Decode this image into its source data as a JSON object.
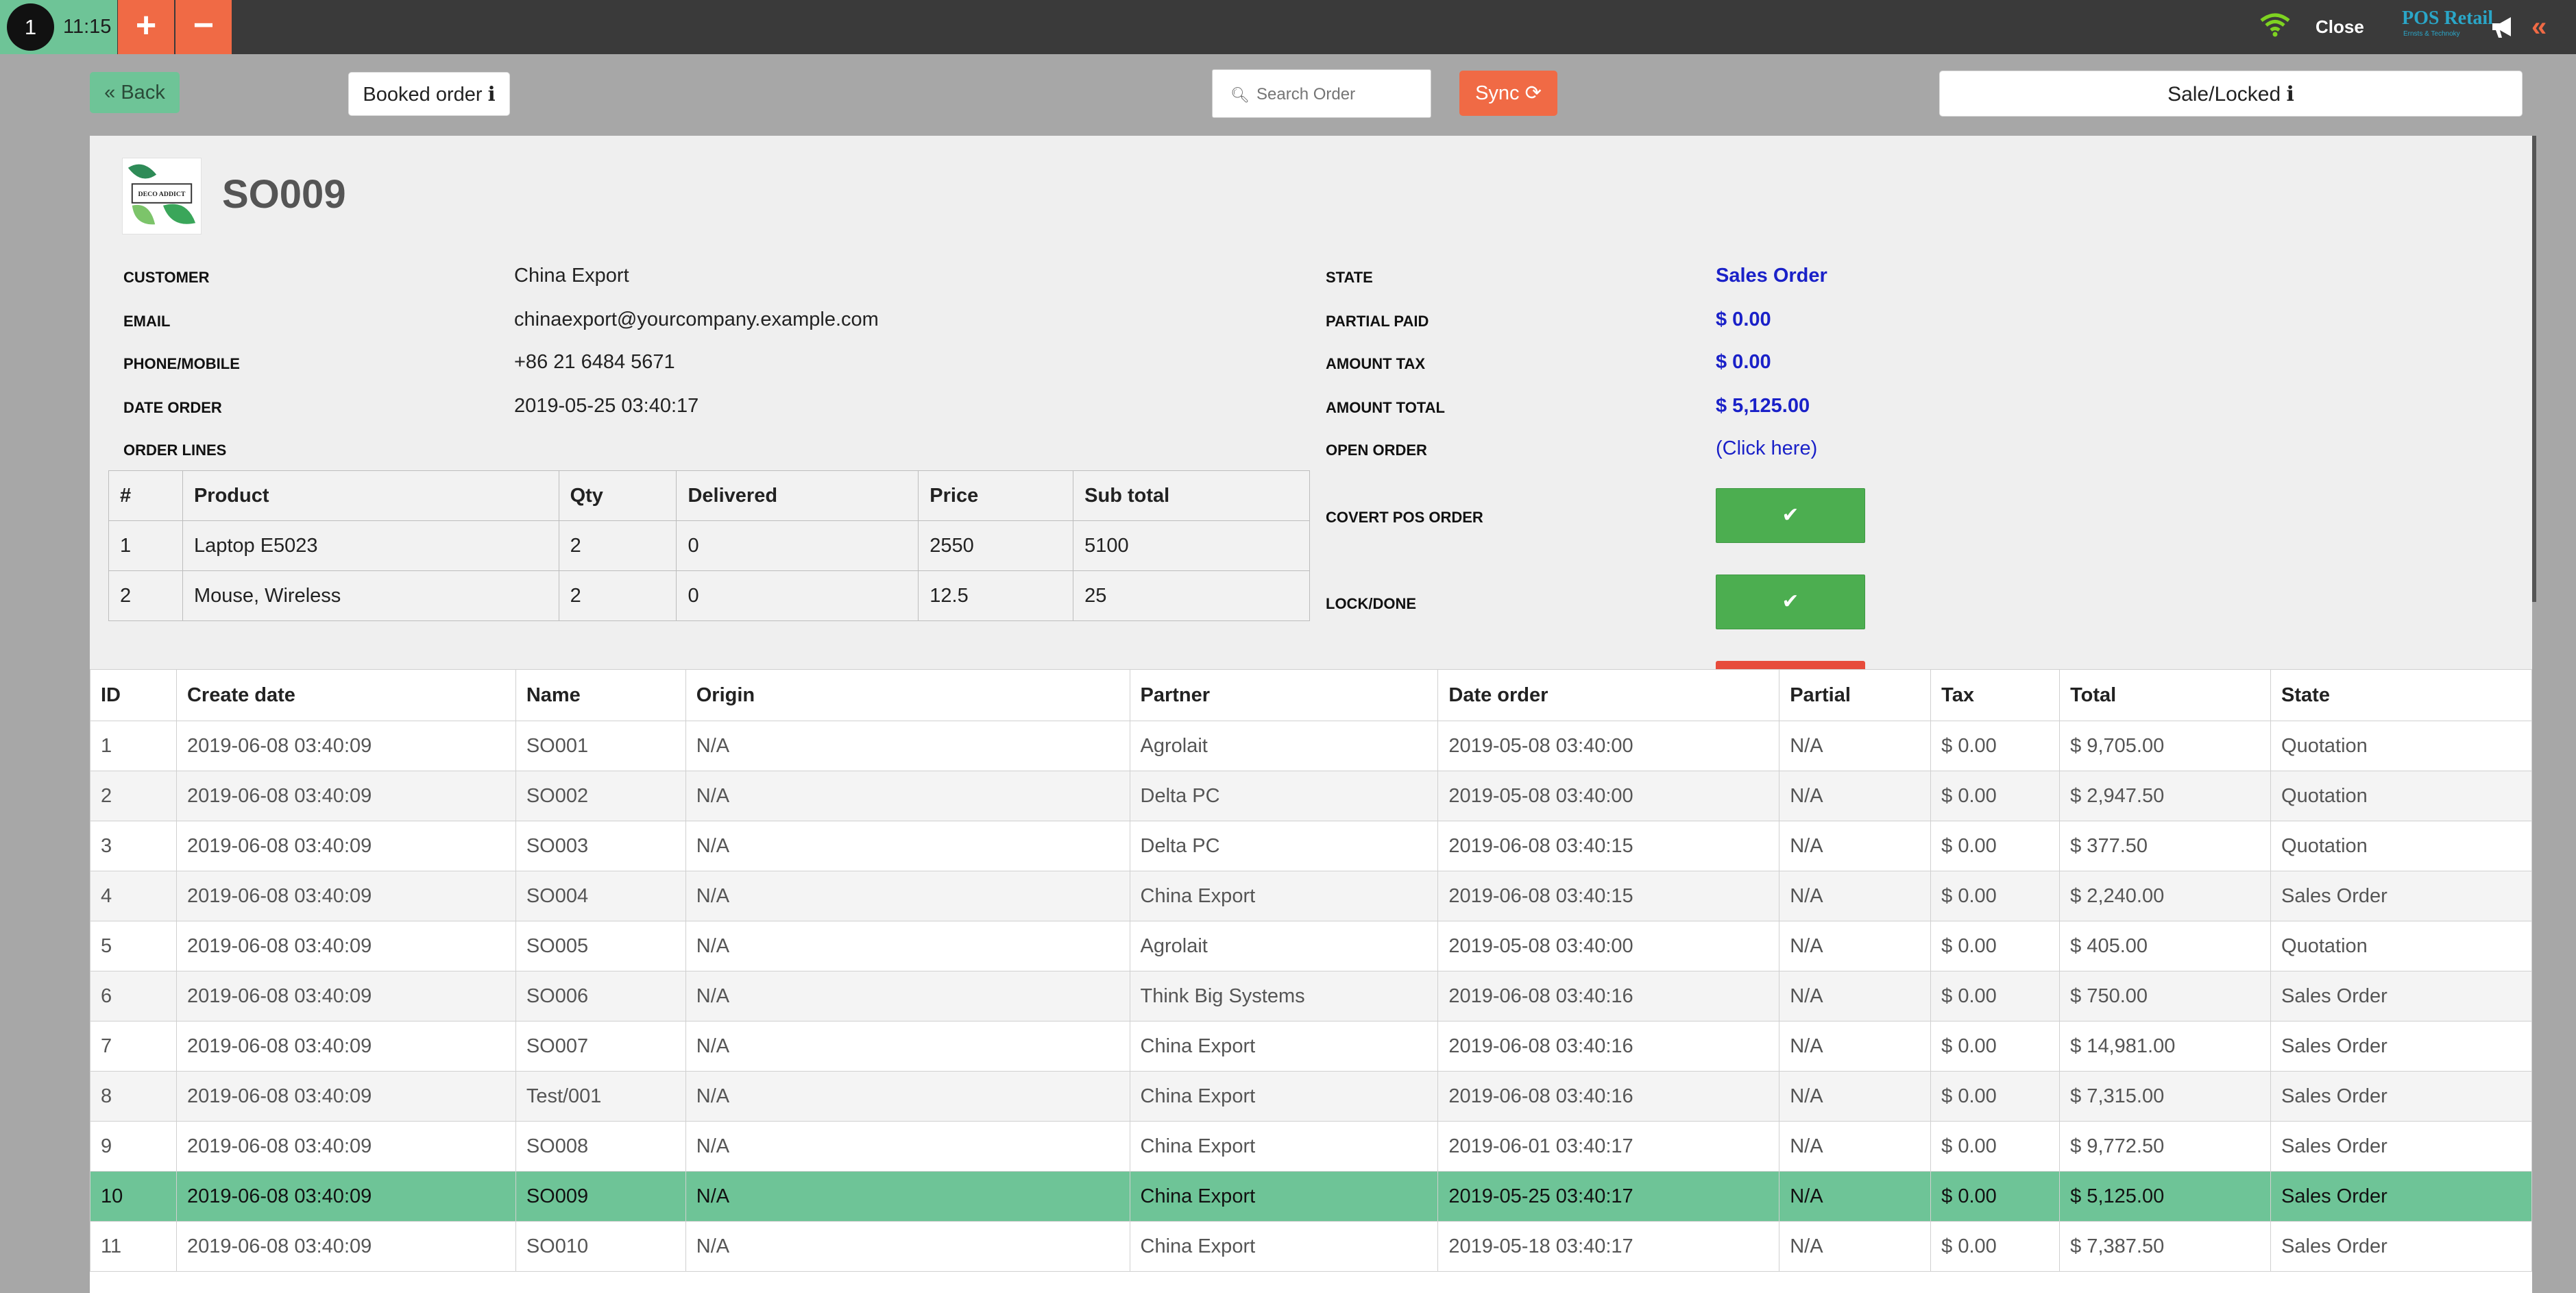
{
  "topbar": {
    "order_number": "1",
    "order_time": "11:15",
    "add_label": "+",
    "remove_label": "−",
    "close_label": "Close",
    "logo_text": "POS Retail",
    "logo_sub": "Ernsts & Technoky",
    "collapse_label": "«"
  },
  "toolbar": {
    "back_label": "« Back",
    "booked_label": "Booked order ℹ",
    "search_placeholder": "Search Order",
    "sync_label": "Sync ⟳",
    "sale_locked_label": "Sale/Locked ℹ"
  },
  "detail": {
    "logo_text": "DECO ADDICT",
    "title": "SO009",
    "left_fields": [
      {
        "label": "CUSTOMER",
        "value": "China Export"
      },
      {
        "label": "EMAIL",
        "value": "chinaexport@yourcompany.example.com"
      },
      {
        "label": "PHONE/MOBILE",
        "value": "+86 21 6484 5671"
      },
      {
        "label": "DATE ORDER",
        "value": "2019-05-25 03:40:17"
      }
    ],
    "order_lines_label": "ORDER LINES",
    "right_fields": [
      {
        "label": "STATE",
        "value": "Sales Order"
      },
      {
        "label": "PARTIAL PAID",
        "value": "$ 0.00"
      },
      {
        "label": "AMOUNT TAX",
        "value": "$ 0.00"
      },
      {
        "label": "AMOUNT TOTAL",
        "value": "$ 5,125.00"
      }
    ],
    "open_order_label": "OPEN ORDER",
    "open_order_link": "(Click here)",
    "covert_label": "COVERT POS ORDER",
    "lock_label": "LOCK/DONE",
    "check_glyph": "✔",
    "lines_headers": [
      "#",
      "Product",
      "Qty",
      "Delivered",
      "Price",
      "Sub total"
    ],
    "lines": [
      [
        "1",
        "Laptop E5023",
        "2",
        "0",
        "2550",
        "5100"
      ],
      [
        "2",
        "Mouse, Wireless",
        "2",
        "0",
        "12.5",
        "25"
      ]
    ]
  },
  "orders": {
    "headers": [
      "ID",
      "Create date",
      "Name",
      "Origin",
      "Partner",
      "Date order",
      "Partial",
      "Tax",
      "Total",
      "State"
    ],
    "rows": [
      [
        "1",
        "2019-06-08 03:40:09",
        "SO001",
        "N/A",
        "Agrolait",
        "2019-05-08 03:40:00",
        "N/A",
        "$ 0.00",
        "$ 9,705.00",
        "Quotation"
      ],
      [
        "2",
        "2019-06-08 03:40:09",
        "SO002",
        "N/A",
        "Delta PC",
        "2019-05-08 03:40:00",
        "N/A",
        "$ 0.00",
        "$ 2,947.50",
        "Quotation"
      ],
      [
        "3",
        "2019-06-08 03:40:09",
        "SO003",
        "N/A",
        "Delta PC",
        "2019-06-08 03:40:15",
        "N/A",
        "$ 0.00",
        "$ 377.50",
        "Quotation"
      ],
      [
        "4",
        "2019-06-08 03:40:09",
        "SO004",
        "N/A",
        "China Export",
        "2019-06-08 03:40:15",
        "N/A",
        "$ 0.00",
        "$ 2,240.00",
        "Sales Order"
      ],
      [
        "5",
        "2019-06-08 03:40:09",
        "SO005",
        "N/A",
        "Agrolait",
        "2019-05-08 03:40:00",
        "N/A",
        "$ 0.00",
        "$ 405.00",
        "Quotation"
      ],
      [
        "6",
        "2019-06-08 03:40:09",
        "SO006",
        "N/A",
        "Think Big Systems",
        "2019-06-08 03:40:16",
        "N/A",
        "$ 0.00",
        "$ 750.00",
        "Sales Order"
      ],
      [
        "7",
        "2019-06-08 03:40:09",
        "SO007",
        "N/A",
        "China Export",
        "2019-06-08 03:40:16",
        "N/A",
        "$ 0.00",
        "$ 14,981.00",
        "Sales Order"
      ],
      [
        "8",
        "2019-06-08 03:40:09",
        "Test/001",
        "N/A",
        "China Export",
        "2019-06-08 03:40:16",
        "N/A",
        "$ 0.00",
        "$ 7,315.00",
        "Sales Order"
      ],
      [
        "9",
        "2019-06-08 03:40:09",
        "SO008",
        "N/A",
        "China Export",
        "2019-06-01 03:40:17",
        "N/A",
        "$ 0.00",
        "$ 9,772.50",
        "Sales Order"
      ],
      [
        "10",
        "2019-06-08 03:40:09",
        "SO009",
        "N/A",
        "China Export",
        "2019-05-25 03:40:17",
        "N/A",
        "$ 0.00",
        "$ 5,125.00",
        "Sales Order"
      ],
      [
        "11",
        "2019-06-08 03:40:09",
        "SO010",
        "N/A",
        "China Export",
        "2019-05-18 03:40:17",
        "N/A",
        "$ 0.00",
        "$ 7,387.50",
        "Sales Order"
      ]
    ],
    "selected_row": 9
  },
  "colors": {
    "accent_green": "#6ec497",
    "accent_orange": "#f06a45",
    "value_blue": "#1a21c8",
    "button_green": "#4cae50"
  }
}
